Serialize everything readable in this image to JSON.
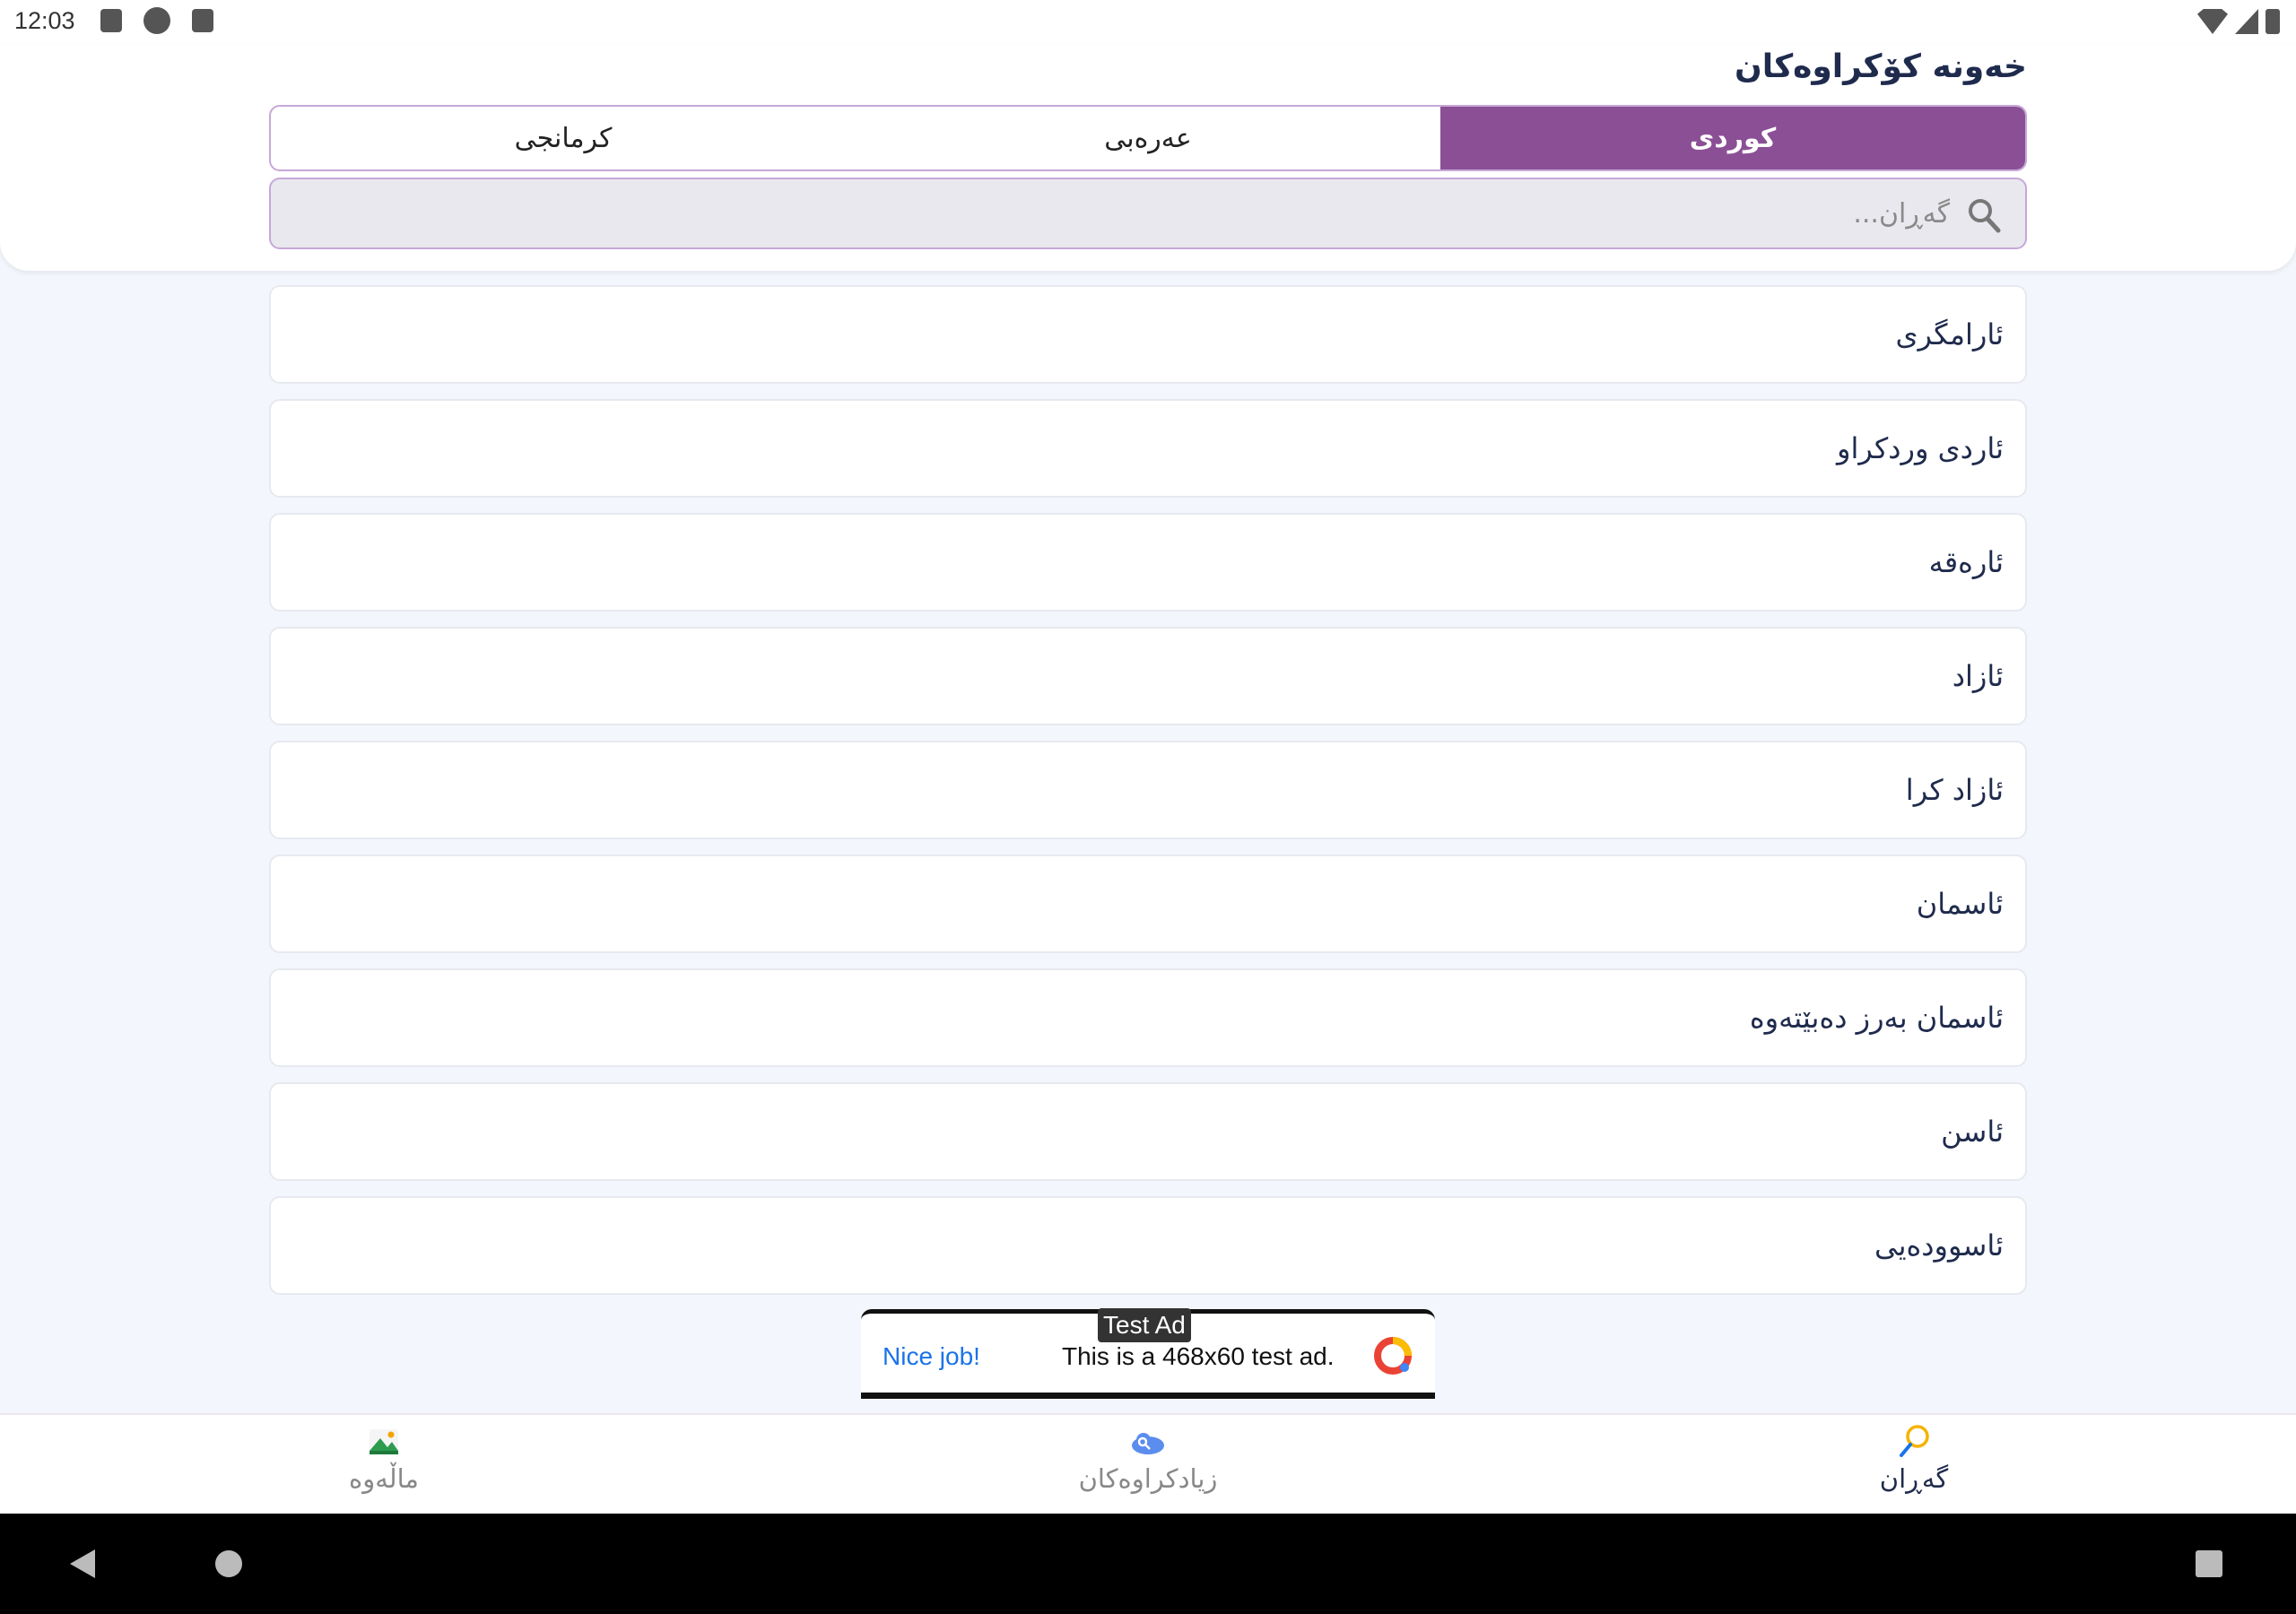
{
  "status_bar": {
    "time": "12:03",
    "left_icons": [
      "font-icon",
      "app-icon",
      "sd-card-icon"
    ],
    "right_icons": [
      "wifi-icon",
      "signal-icon",
      "battery-icon"
    ]
  },
  "header": {
    "title": "خەونە کۆکراوەکان"
  },
  "language_tabs": [
    {
      "label": "کوردی",
      "active": true
    },
    {
      "label": "عەرەبی",
      "active": false
    },
    {
      "label": "کرمانجی",
      "active": false
    }
  ],
  "search": {
    "placeholder": "گەڕان...",
    "value": ""
  },
  "list_items": [
    "ئارامگری",
    "ئاردی وردکراو",
    "ئارەقە",
    "ئازاد",
    "ئازاد کرا",
    "ئاسمان",
    "ئاسمان بەرز دەبێتەوە",
    "ئاسن",
    "ئاسوودەیی"
  ],
  "ad": {
    "label": "Test Ad",
    "cta": "Nice job!",
    "text": "This is a 468x60 test ad."
  },
  "bottom_nav": {
    "home_label": "ماڵەوە",
    "added_label": "زیادکراوەکان",
    "search_label": "گەڕان",
    "active": "search"
  },
  "colors": {
    "accent": "#8b4f96",
    "title": "#1f2b4d",
    "background": "#f3f6fc"
  }
}
